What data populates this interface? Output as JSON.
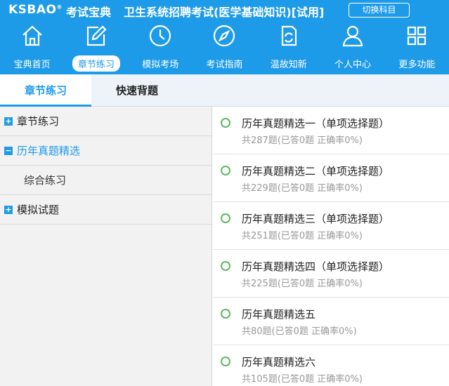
{
  "header": {
    "logo_text": "KSBAO",
    "logo_mark": "®",
    "logo_cn": "考试宝典",
    "title": "卫生系统招聘考试(医学基础知识)[试用]",
    "switch_label": "切换科目"
  },
  "nav": [
    {
      "label": "宝典首页",
      "icon": "home-icon"
    },
    {
      "label": "章节练习",
      "icon": "edit-icon",
      "active": true
    },
    {
      "label": "模拟考场",
      "icon": "clock-icon"
    },
    {
      "label": "考试指南",
      "icon": "compass-icon"
    },
    {
      "label": "温故知新",
      "icon": "refresh-icon"
    },
    {
      "label": "个人中心",
      "icon": "user-icon"
    },
    {
      "label": "更多功能",
      "icon": "grid-icon"
    }
  ],
  "tabs": [
    "章节练习",
    "快速背题"
  ],
  "sidebar": [
    {
      "label": "章节练习",
      "toggle": "+"
    },
    {
      "label": "历年真题精选",
      "toggle": "−",
      "active": true
    },
    {
      "label": "综合练习"
    },
    {
      "label": "模拟试题",
      "toggle": "+"
    }
  ],
  "items": [
    {
      "title": "历年真题精选一（单项选择题）",
      "stats": "共287题(已答0题   正确率0%)"
    },
    {
      "title": "历年真题精选二（单项选择题）",
      "stats": "共229题(已答0题   正确率0%)"
    },
    {
      "title": "历年真题精选三（单项选择题）",
      "stats": "共251题(已答0题   正确率0%)"
    },
    {
      "title": "历年真题精选四（单项选择题）",
      "stats": "共225题(已答0题   正确率0%)"
    },
    {
      "title": "历年真题精选五",
      "stats": "共80题(已答0题   正确率0%)"
    },
    {
      "title": "历年真题精选六",
      "stats": "共105题(已答0题   正确率0%)"
    }
  ],
  "colors": {
    "primary": "#1e9be8",
    "check": "#5cb85c"
  }
}
